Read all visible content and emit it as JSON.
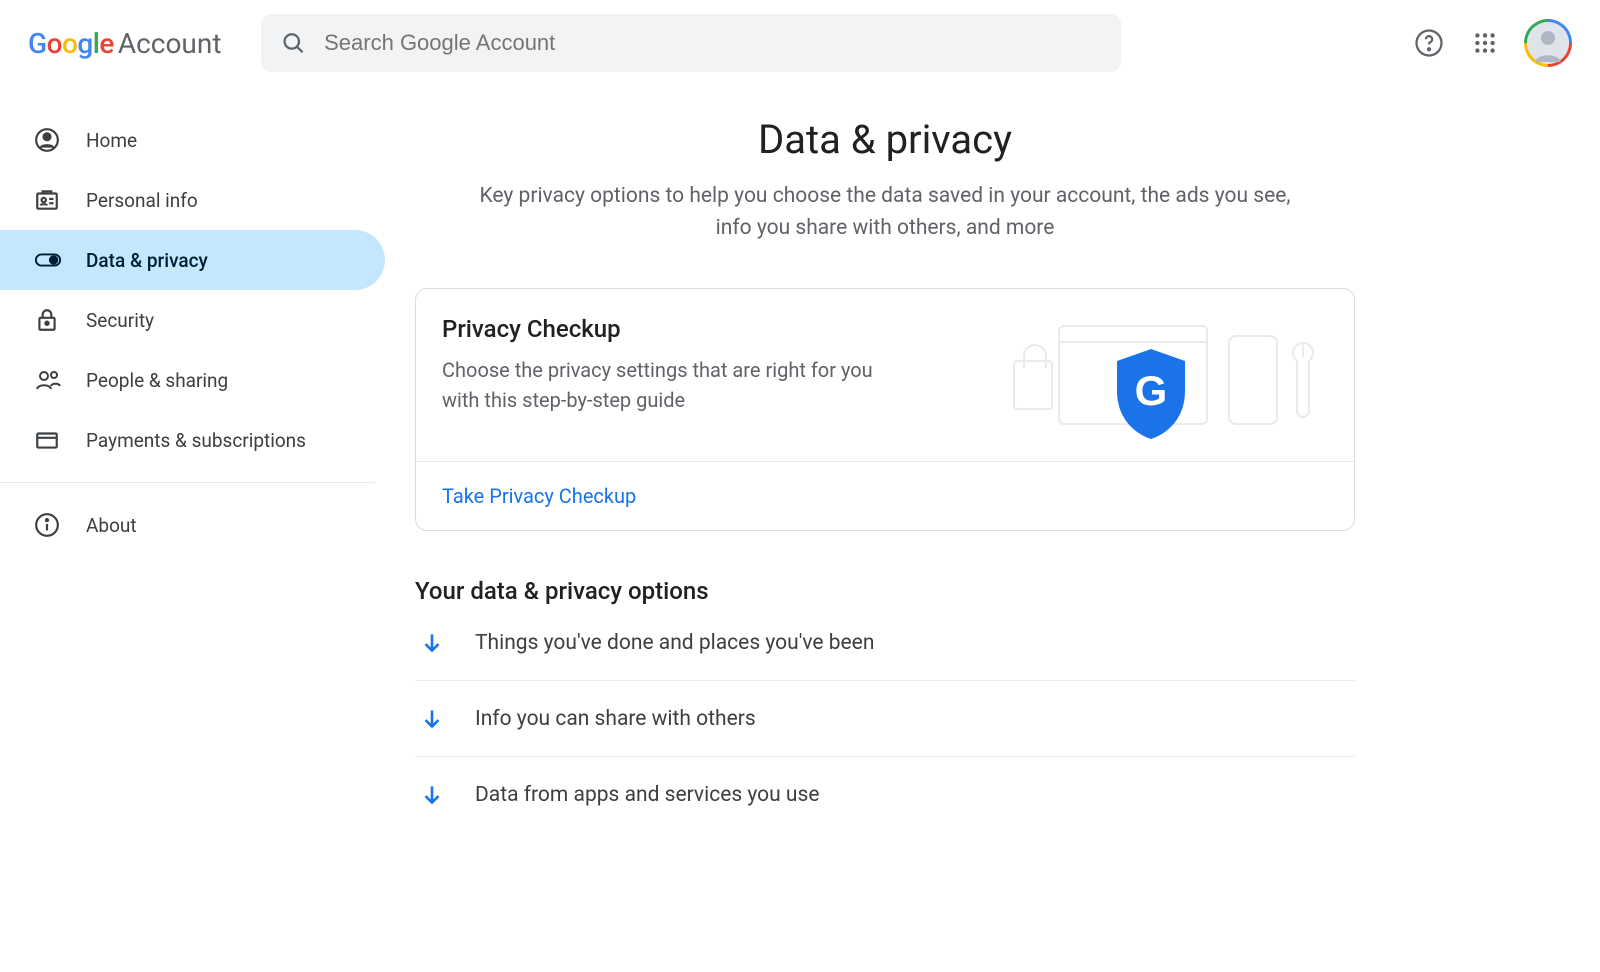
{
  "header": {
    "logo_account": "Account",
    "search_placeholder": "Search Google Account"
  },
  "sidebar": {
    "items": [
      {
        "label": "Home"
      },
      {
        "label": "Personal info"
      },
      {
        "label": "Data & privacy"
      },
      {
        "label": "Security"
      },
      {
        "label": "People & sharing"
      },
      {
        "label": "Payments & subscriptions"
      }
    ],
    "about_label": "About"
  },
  "main": {
    "title": "Data & privacy",
    "subtitle": "Key privacy options to help you choose the data saved in your account, the ads you see, info you share with others, and more",
    "card": {
      "title": "Privacy Checkup",
      "desc": "Choose the privacy settings that are right for you with this step-by-step guide",
      "link": "Take Privacy Checkup"
    },
    "options_title": "Your data & privacy options",
    "options": [
      {
        "label": "Things you've done and places you've been"
      },
      {
        "label": "Info you can share with others"
      },
      {
        "label": "Data from apps and services you use"
      }
    ]
  }
}
